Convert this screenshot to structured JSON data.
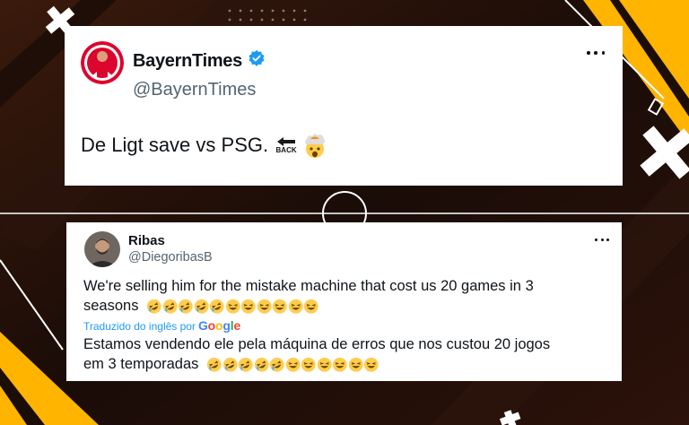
{
  "colors": {
    "accent_yellow": "#ffb400",
    "verified_blue": "#1d9bf0",
    "handle_gray": "#536471"
  },
  "tweet_top": {
    "display_name": "BayernTimes",
    "handle": "@BayernTimes",
    "verified": true,
    "text": "De Ligt save vs PSG.",
    "emoji_labels": {
      "back_arrow": "BACK"
    },
    "emojis": [
      "back-arrow",
      "exploding-head"
    ]
  },
  "tweet_bottom": {
    "display_name": "Ribas",
    "handle": "@DiegoribasB",
    "text_line1": "We're selling him for the mistake machine that cost us 20 games in 3",
    "text_line2": "seasons",
    "emojis": [
      "rofl",
      "rofl",
      "rofl",
      "rofl",
      "rofl",
      "laughing",
      "laughing",
      "laughing",
      "laughing",
      "laughing",
      "laughing"
    ],
    "translated_label": "Traduzido do inglês por",
    "translator": "Google",
    "translation_line1": "Estamos vendendo ele pela máquina de erros que nos custou 20 jogos",
    "translation_line2": "em 3 temporadas"
  }
}
